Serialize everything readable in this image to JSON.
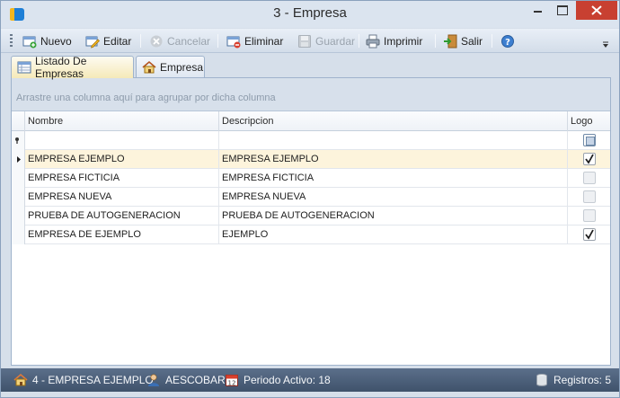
{
  "window": {
    "title": "3 - Empresa"
  },
  "toolbar": {
    "nuevo": "Nuevo",
    "editar": "Editar",
    "cancelar": "Cancelar",
    "eliminar": "Eliminar",
    "guardar": "Guardar",
    "imprimir": "Imprimir",
    "salir": "Salir"
  },
  "tabs": [
    "Listado De Empresas",
    "Empresa"
  ],
  "grid": {
    "group_hint": "Arrastre una columna aquí para agrupar por dicha columna",
    "columns": [
      "Nombre",
      "Descripcion",
      "Logo"
    ],
    "rows": [
      {
        "nombre": "EMPRESA EJEMPLO",
        "descripcion": "EMPRESA EJEMPLO",
        "logo": true
      },
      {
        "nombre": "EMPRESA FICTICIA",
        "descripcion": "EMPRESA FICTICIA",
        "logo": false
      },
      {
        "nombre": "EMPRESA NUEVA",
        "descripcion": "EMPRESA NUEVA",
        "logo": false
      },
      {
        "nombre": "PRUEBA DE AUTOGENERACION",
        "descripcion": "PRUEBA DE AUTOGENERACION",
        "logo": false
      },
      {
        "nombre": "EMPRESA DE EJEMPLO",
        "descripcion": "EJEMPLO",
        "logo": true
      }
    ]
  },
  "status": {
    "empresa": "4 - EMPRESA EJEMPLO",
    "usuario": "AESCOBAR",
    "periodo": "Periodo Activo: 18",
    "registros": "Registros: 5"
  }
}
